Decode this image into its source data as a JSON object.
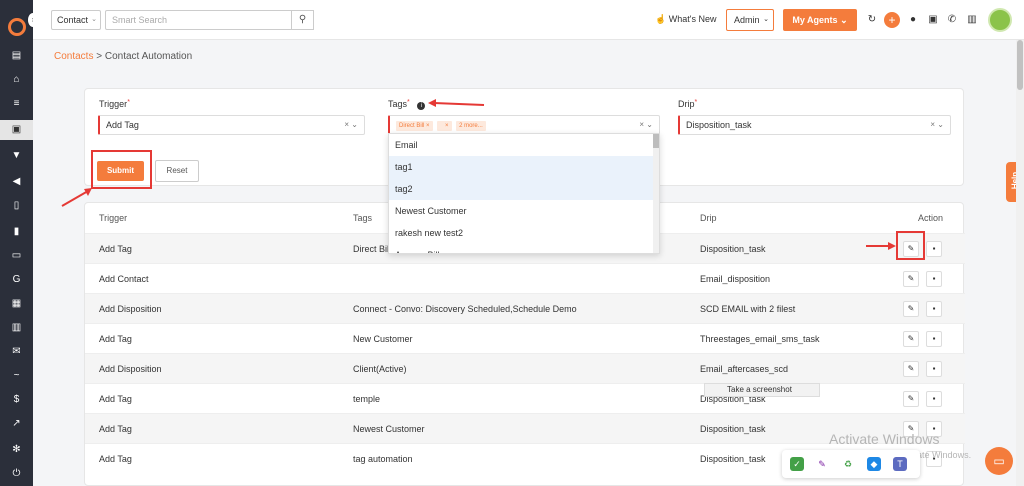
{
  "colors": {
    "accent": "#f47c3c",
    "sidebar": "#2b2f3a",
    "annotation": "#e53935"
  },
  "topbar": {
    "contact_select": "Contact",
    "search_placeholder": "Smart Search",
    "whats_new": "What's New",
    "admin_select": "Admin",
    "my_agents": "My Agents"
  },
  "breadcrumb": {
    "parent": "Contacts",
    "separator": " > ",
    "current": "Contact Automation"
  },
  "form": {
    "trigger": {
      "label": "Trigger",
      "value": "Add Tag"
    },
    "tags": {
      "label": "Tags",
      "chips": [
        "Direct Bill",
        "2 more..."
      ]
    },
    "drip": {
      "label": "Drip",
      "value": "Disposition_task"
    },
    "submit_label": "Submit",
    "reset_label": "Reset"
  },
  "tag_dropdown": {
    "options": [
      "Email",
      "tag1",
      "tag2",
      "Newest  Customer",
      "rakesh new test2",
      "Agency Bill"
    ]
  },
  "table": {
    "headers": [
      "Trigger",
      "Tags",
      "Drip",
      "Action"
    ],
    "rows": [
      {
        "trigger": "Add Tag",
        "tags": "Direct Bil",
        "drip": "Disposition_task"
      },
      {
        "trigger": "Add Contact",
        "tags": "",
        "drip": "Email_disposition"
      },
      {
        "trigger": "Add Disposition",
        "tags": "Connect - Convo: Discovery Scheduled,Schedule Demo",
        "drip": "SCD EMAIL with 2 filest"
      },
      {
        "trigger": "Add Tag",
        "tags": "New Customer",
        "drip": "Threestages_email_sms_task"
      },
      {
        "trigger": "Add Disposition",
        "tags": "Client(Active)",
        "drip": "Email_aftercases_scd"
      },
      {
        "trigger": "Add Tag",
        "tags": "temple",
        "drip": "Disposition_task"
      },
      {
        "trigger": "Add Tag",
        "tags": "Newest Customer",
        "drip": "Disposition_task"
      },
      {
        "trigger": "Add Tag",
        "tags": "tag automation",
        "drip": "Disposition_task"
      }
    ]
  },
  "tooltip": "Take a screenshot",
  "watermark": {
    "title": "Activate Windows",
    "subtitle": "Go to Settings to activate Windows."
  },
  "help_label": "Help"
}
